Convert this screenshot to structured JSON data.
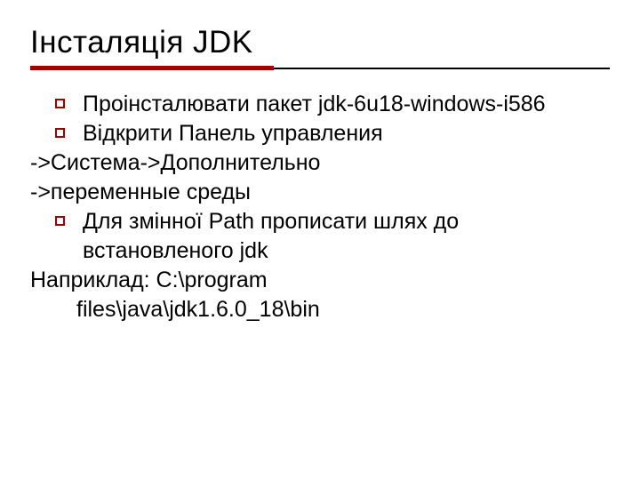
{
  "slide": {
    "title": "Інсталяція JDK",
    "bullets": [
      "Проінсталювати пакет jdk-6u18-windows-i586",
      "Відкрити Панель управления",
      "Для змінної Path прописати шлях до встановленого jdk"
    ],
    "lines": {
      "arrow1": "->Система->Дополнительно",
      "arrow2": "->переменные среды",
      "example_label": "Наприклад: C:\\program",
      "example_path": "files\\java\\jdk1.6.0_18\\bin"
    }
  }
}
